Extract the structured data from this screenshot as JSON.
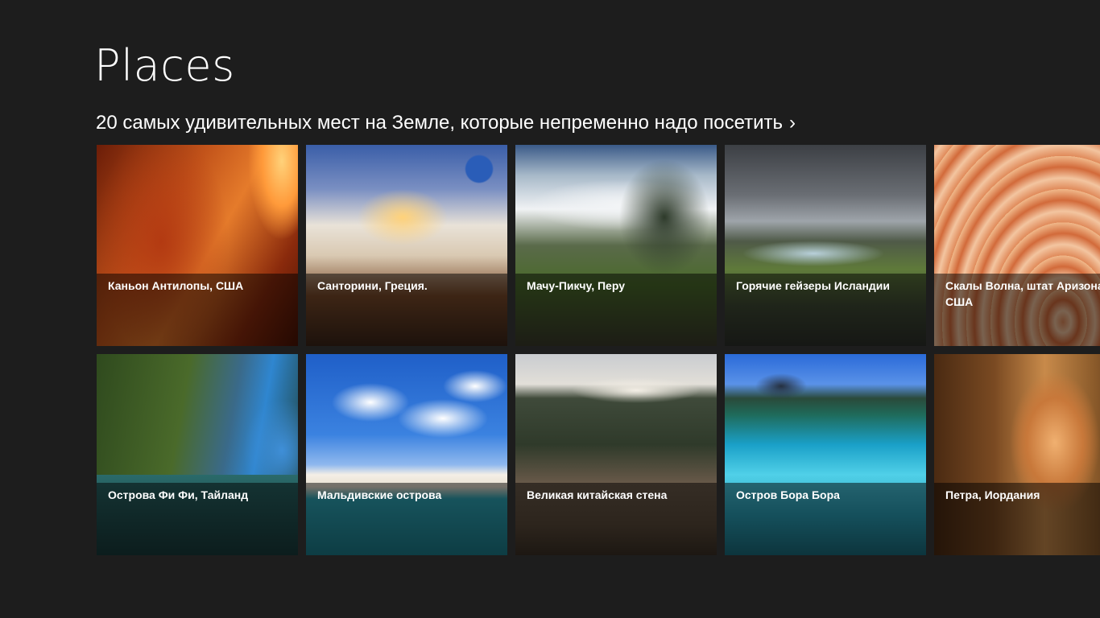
{
  "page": {
    "title": "Places"
  },
  "section": {
    "header": "20 самых удивительных мест на Земле, которые непременно надо посетить",
    "chevron": "›"
  },
  "tiles": [
    {
      "caption": "Каньон Антилопы, США"
    },
    {
      "caption": "Санторини, Греция."
    },
    {
      "caption": "Мачу-Пикчу, Перу"
    },
    {
      "caption": "Горячие гейзеры Исландии"
    },
    {
      "caption": "Скалы Волна, штат Аризона, США"
    },
    {
      "caption": "Острова Фи Фи, Тайланд"
    },
    {
      "caption": "Мальдивские острова"
    },
    {
      "caption": "Великая китайская стена"
    },
    {
      "caption": "Остров Бора Бора"
    },
    {
      "caption": "Петра, Иордания"
    }
  ],
  "colors": {
    "background": "#1d1d1d",
    "text": "#ffffff",
    "caption_overlay": "rgba(0,0,0,0.5)"
  }
}
